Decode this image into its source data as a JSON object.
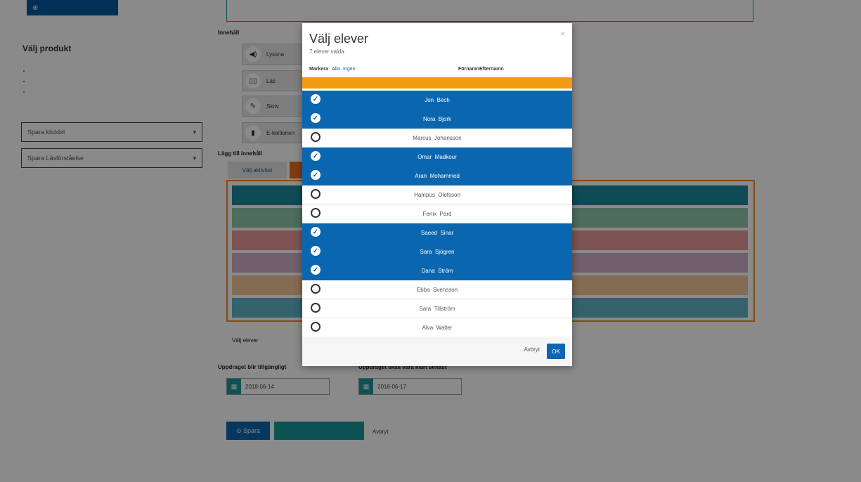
{
  "background": {
    "top_button": "",
    "left": {
      "title": "Välj produkt",
      "subtitle": "",
      "links": [
        "",
        "",
        ""
      ],
      "dropdowns": [
        "Spara klickbit",
        "Spara Läsförståelse"
      ]
    },
    "main": {
      "label_innehall": "Innehåll",
      "options": [
        "Lyssna",
        "Läs",
        "Skriv",
        "E-lektionen"
      ],
      "label_lagg_till": "Lägg till innehåll",
      "tab_left": "Välj aktivitet",
      "list_rows": [
        "",
        "",
        "",
        "",
        "",
        ""
      ],
      "choose_students": "Välj elever",
      "date_label_1": "Uppdraget blir tillgängligt",
      "date_label_2": "Uppdraget skall vara klart senast",
      "date_1": "2018-06-14",
      "date_2": "2018-06-17",
      "save_button": "Spara",
      "save_and_close_button": "",
      "cancel_link": "Avbryt"
    }
  },
  "modal": {
    "title": "Välj elever",
    "subtitle": "7 elever valda",
    "header_mark_label": "Markera",
    "header_all": "Alla",
    "header_none": "Ingen",
    "header_first": "Förnamn",
    "header_last": "Efternamn",
    "warning": "",
    "students": [
      {
        "first": "Jon",
        "last": "Bech",
        "selected": true
      },
      {
        "first": "Nora",
        "last": "Bjork",
        "selected": true
      },
      {
        "first": "Marcus",
        "last": "Johansson",
        "selected": false
      },
      {
        "first": "Omar",
        "last": "Madkour",
        "selected": true
      },
      {
        "first": "Aran",
        "last": "Mohammed",
        "selected": true
      },
      {
        "first": "Hampus",
        "last": "Olofsson",
        "selected": false
      },
      {
        "first": "Fenix",
        "last": "Pard",
        "selected": false
      },
      {
        "first": "Saeed",
        "last": "Sinar",
        "selected": true
      },
      {
        "first": "Sara",
        "last": "Sjögren",
        "selected": true
      },
      {
        "first": "Dana",
        "last": "Ström",
        "selected": true
      },
      {
        "first": "Ebba",
        "last": "Svensson",
        "selected": false
      },
      {
        "first": "Sara",
        "last": "Tillström",
        "selected": false
      },
      {
        "first": "Alva",
        "last": "Walter",
        "selected": false
      }
    ],
    "cancel": "Avbryt",
    "ok": "OK"
  },
  "colors": {
    "primary": "#0b66b0",
    "warning": "#f39c12",
    "teal": "#1a9a9a",
    "orange_border": "#f28c28"
  },
  "icons": [
    "speaker-icon",
    "book-icon",
    "pencil-icon",
    "tablet-icon",
    "calendar-icon",
    "check-icon",
    "close-icon",
    "chevron-down-icon"
  ]
}
